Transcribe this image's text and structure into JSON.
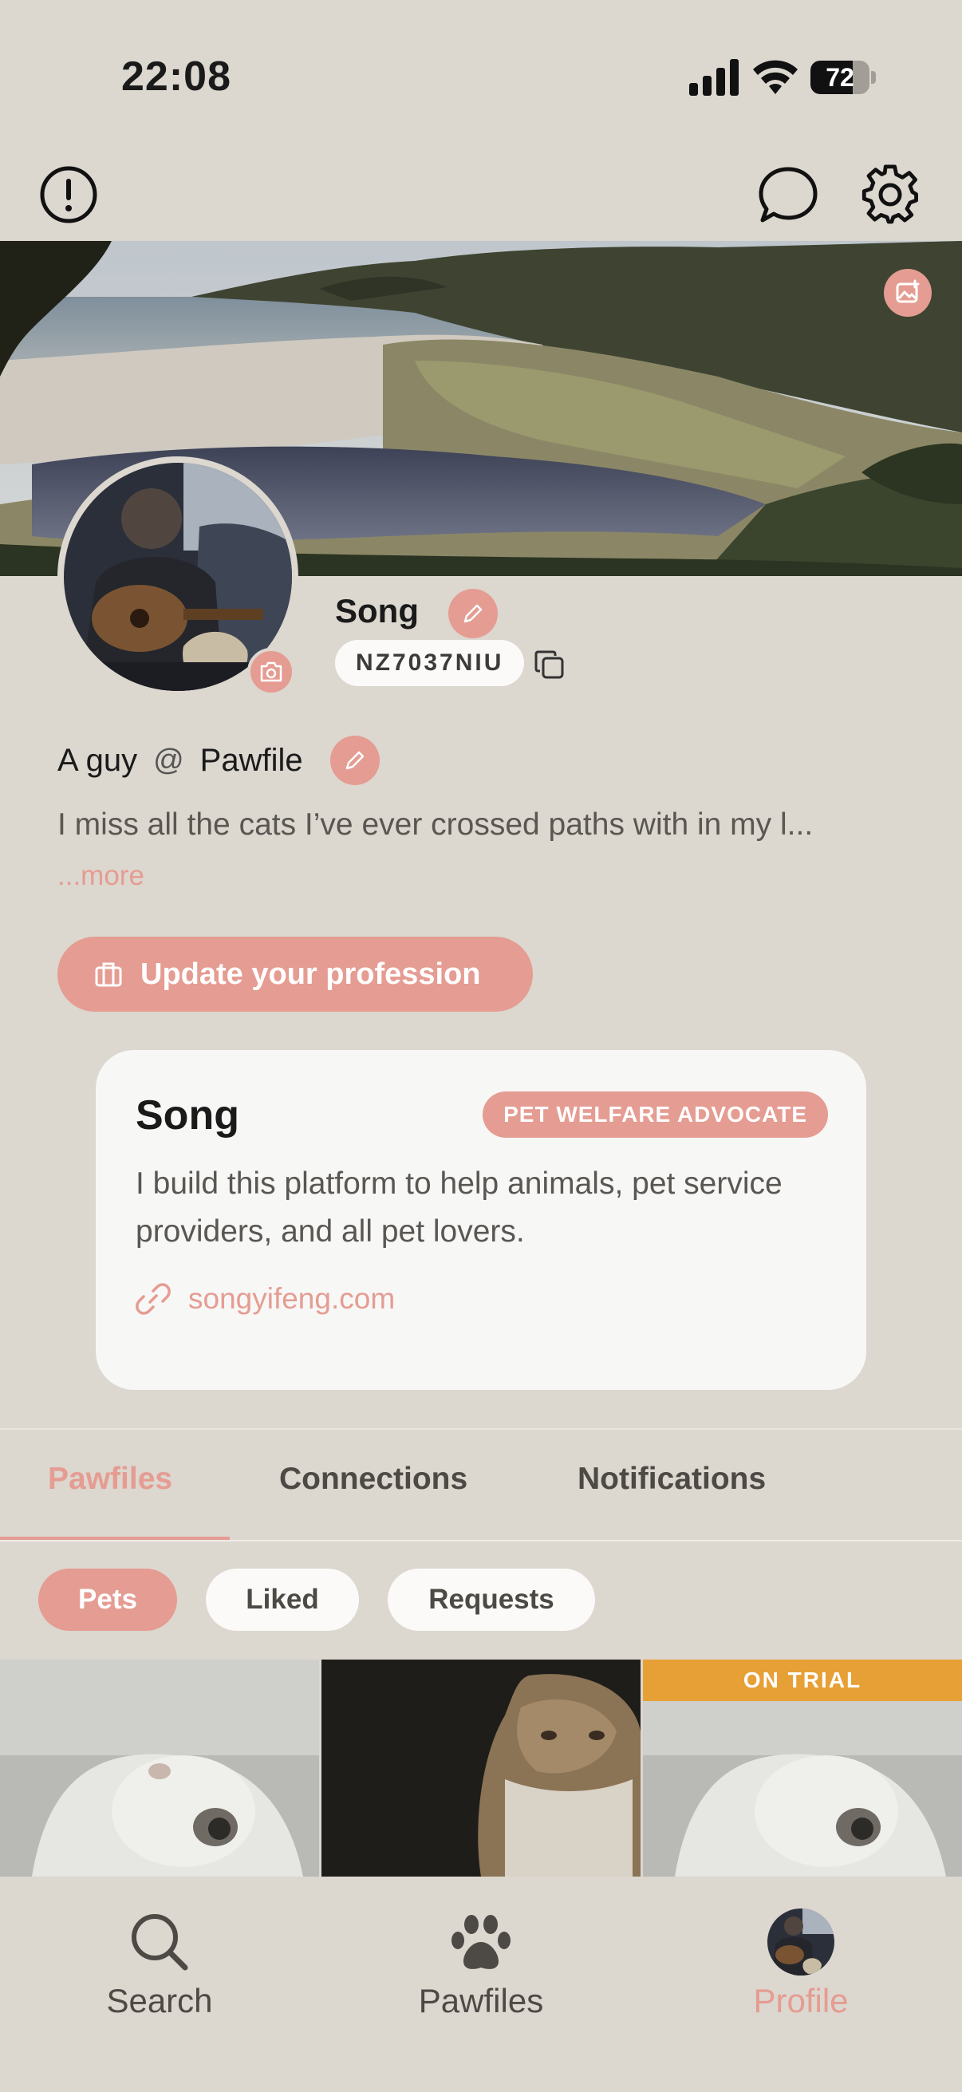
{
  "status_bar": {
    "time": "22:08",
    "battery": "72",
    "battery_level": 0.72
  },
  "profile": {
    "name": "Song",
    "user_id": "NZ7037NIU",
    "tagline_role": "A guy",
    "tagline_at": "@",
    "tagline_place": "Pawfile",
    "bio": "I miss all the cats I’ve ever crossed paths with in my l...",
    "more_label": "...more",
    "profession_button": "Update your profession"
  },
  "card": {
    "name": "Song",
    "badge": "PET WELFARE ADVOCATE",
    "description": "I build this platform to help animals, pet service providers, and all pet lovers.",
    "link": "songyifeng.com"
  },
  "tabs": [
    {
      "label": "Pawfiles",
      "active": true
    },
    {
      "label": "Connections",
      "active": false
    },
    {
      "label": "Notifications",
      "active": false
    }
  ],
  "chips": [
    {
      "label": "Pets",
      "active": true
    },
    {
      "label": "Liked",
      "active": false
    },
    {
      "label": "Requests",
      "active": false
    }
  ],
  "grid": {
    "trial_label": "ON TRIAL"
  },
  "nav": [
    {
      "label": "Search",
      "icon": "search-icon",
      "active": false
    },
    {
      "label": "Pawfiles",
      "icon": "paw-icon",
      "active": false
    },
    {
      "label": "Profile",
      "icon": "avatar",
      "active": true
    }
  ],
  "colors": {
    "accent": "#e59c92",
    "background": "#dcd7cf",
    "card": "#f7f7f6",
    "trial": "#e7a035"
  }
}
